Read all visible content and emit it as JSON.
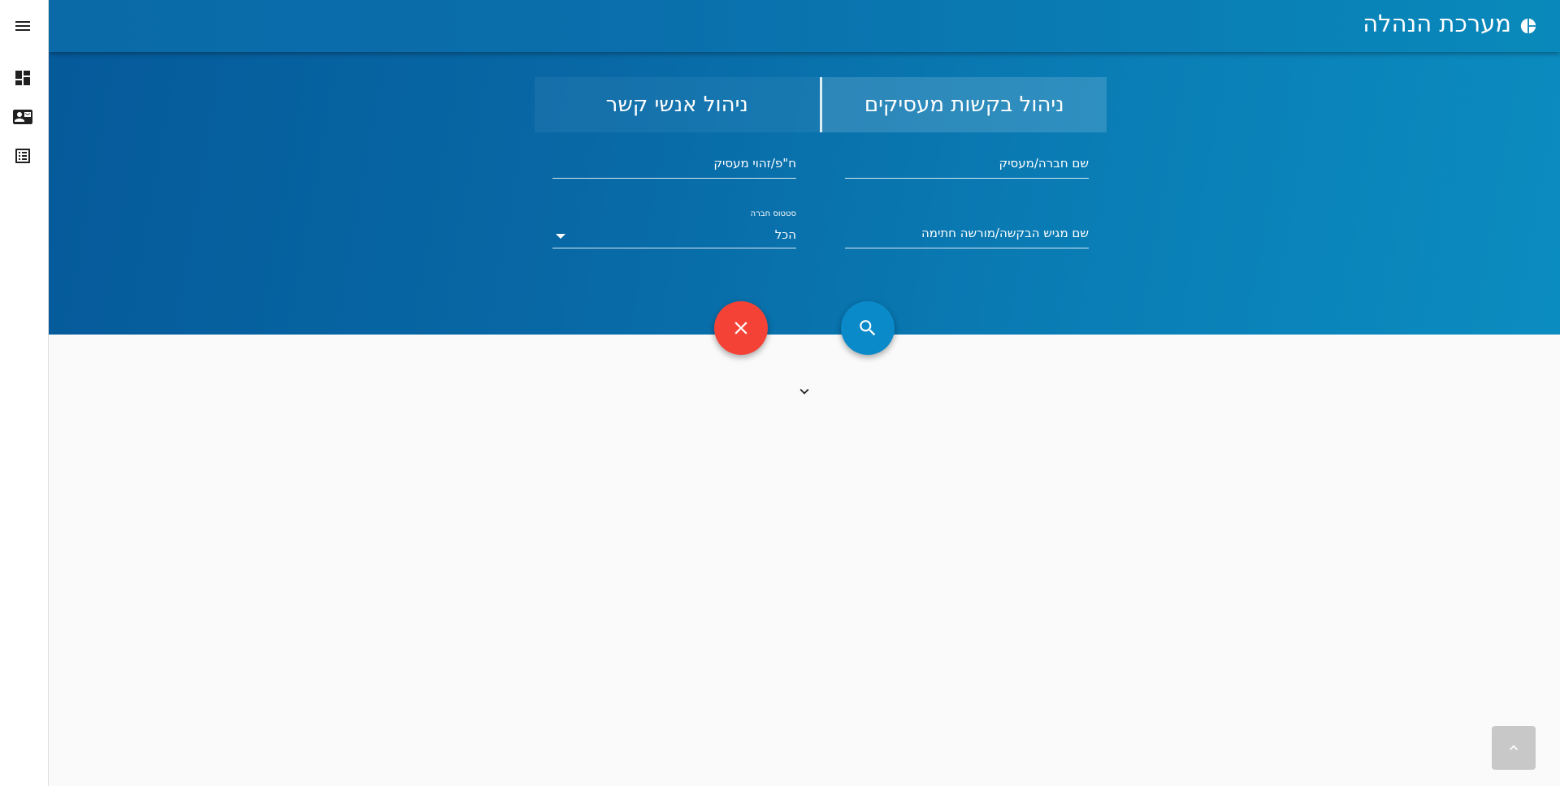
{
  "header": {
    "app_title": "מערכת הנהלה",
    "logo_icon": "pie-chart-icon",
    "menu_icon": "hamburger-menu-icon"
  },
  "sidebar": {
    "items": [
      {
        "icon": "dashboard-icon"
      },
      {
        "icon": "contact-mail-icon"
      },
      {
        "icon": "checklist-icon"
      }
    ]
  },
  "tabs": {
    "employer_requests": "ניהול בקשות מעסיקים",
    "contacts": "ניהול אנשי קשר",
    "active": "employer_requests"
  },
  "form": {
    "company_name_placeholder": "שם חברה/מעסיק",
    "company_id_placeholder": "ח\"פ/זהוי מעסיק",
    "applicant_name_placeholder": "שם מגיש הבקשה/מורשה חתימה",
    "status_label": "סטטוס חברה",
    "status_value": "הכל"
  },
  "actions": {
    "clear_icon": "close-icon",
    "search_icon": "search-icon",
    "expand_icon": "chevron-down-icon",
    "scroll_top_icon": "chevron-up-icon"
  },
  "colors": {
    "primary": "#0a6fac",
    "accent_red": "#f44336",
    "accent_blue": "#0a8ac8",
    "background": "#fafafa"
  }
}
